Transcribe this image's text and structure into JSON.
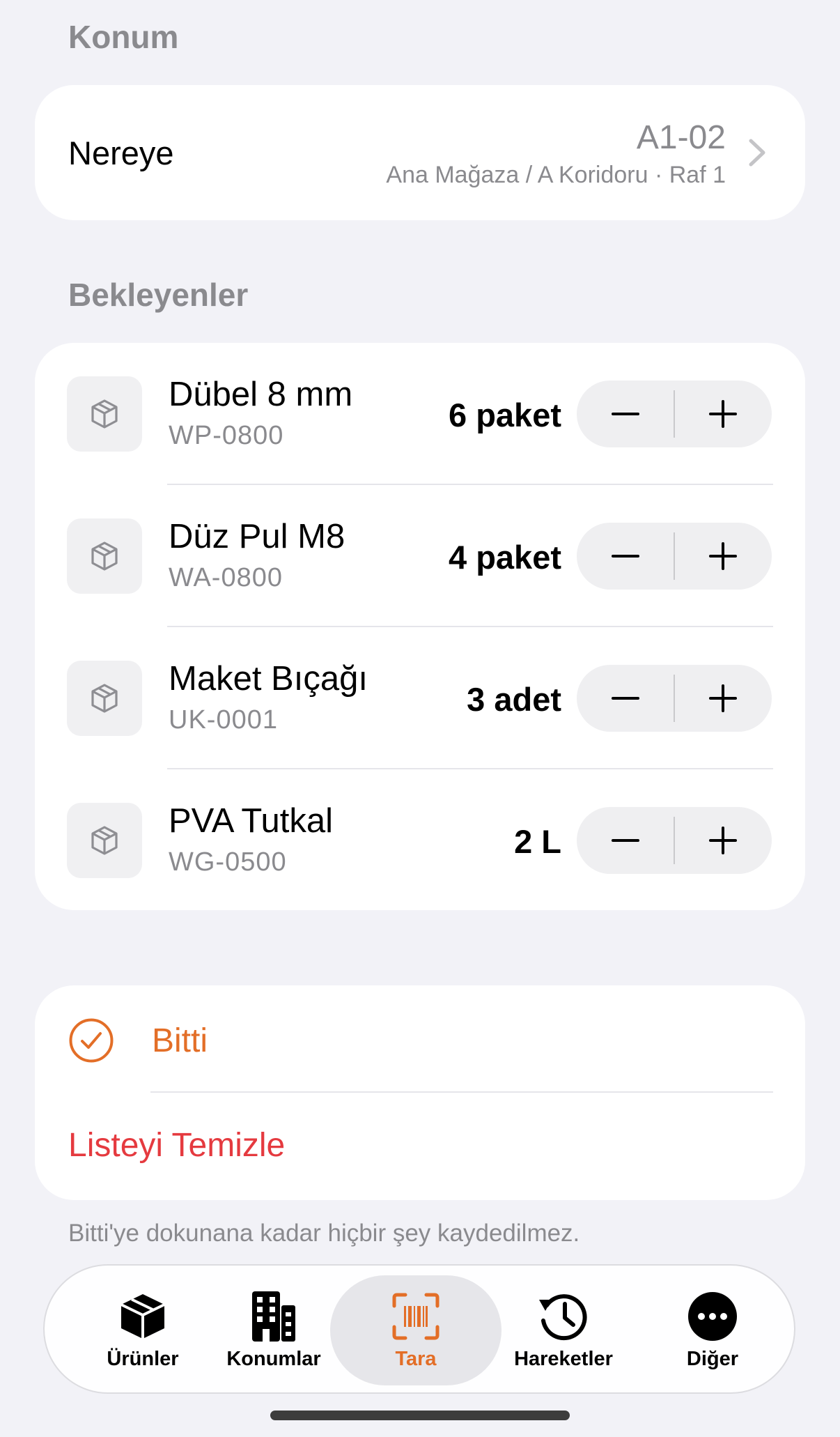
{
  "location_section": {
    "title": "Konum",
    "target_label": "Nereye",
    "code": "A1-02",
    "path": "Ana Mağaza / A Koridoru · Raf 1"
  },
  "pending_section": {
    "title": "Bekleyenler",
    "items": [
      {
        "name": "Dübel 8 mm",
        "sku": "WP-0800",
        "quantity": "6 paket"
      },
      {
        "name": "Düz Pul M8",
        "sku": "WA-0800",
        "quantity": "4 paket"
      },
      {
        "name": "Maket Bıçağı",
        "sku": "UK-0001",
        "quantity": "3 adet"
      },
      {
        "name": "PVA Tutkal",
        "sku": "WG-0500",
        "quantity": "2 L"
      }
    ]
  },
  "actions": {
    "done_label": "Bitti",
    "clear_label": "Listeyi Temizle",
    "footnote": "Bitti'ye dokunana kadar hiçbir şey kaydedilmez."
  },
  "tabbar": {
    "tabs": [
      {
        "label": "Ürünler",
        "icon": "box-icon"
      },
      {
        "label": "Konumlar",
        "icon": "building-icon"
      },
      {
        "label": "Tara",
        "icon": "barcode-scan-icon",
        "active": true
      },
      {
        "label": "Hareketler",
        "icon": "history-icon"
      },
      {
        "label": "Diğer",
        "icon": "more-icon"
      }
    ]
  },
  "colors": {
    "accent": "#e36e27",
    "destructive": "#e53a3f",
    "secondary_text": "#8a8a8e",
    "background": "#f2f2f7"
  }
}
